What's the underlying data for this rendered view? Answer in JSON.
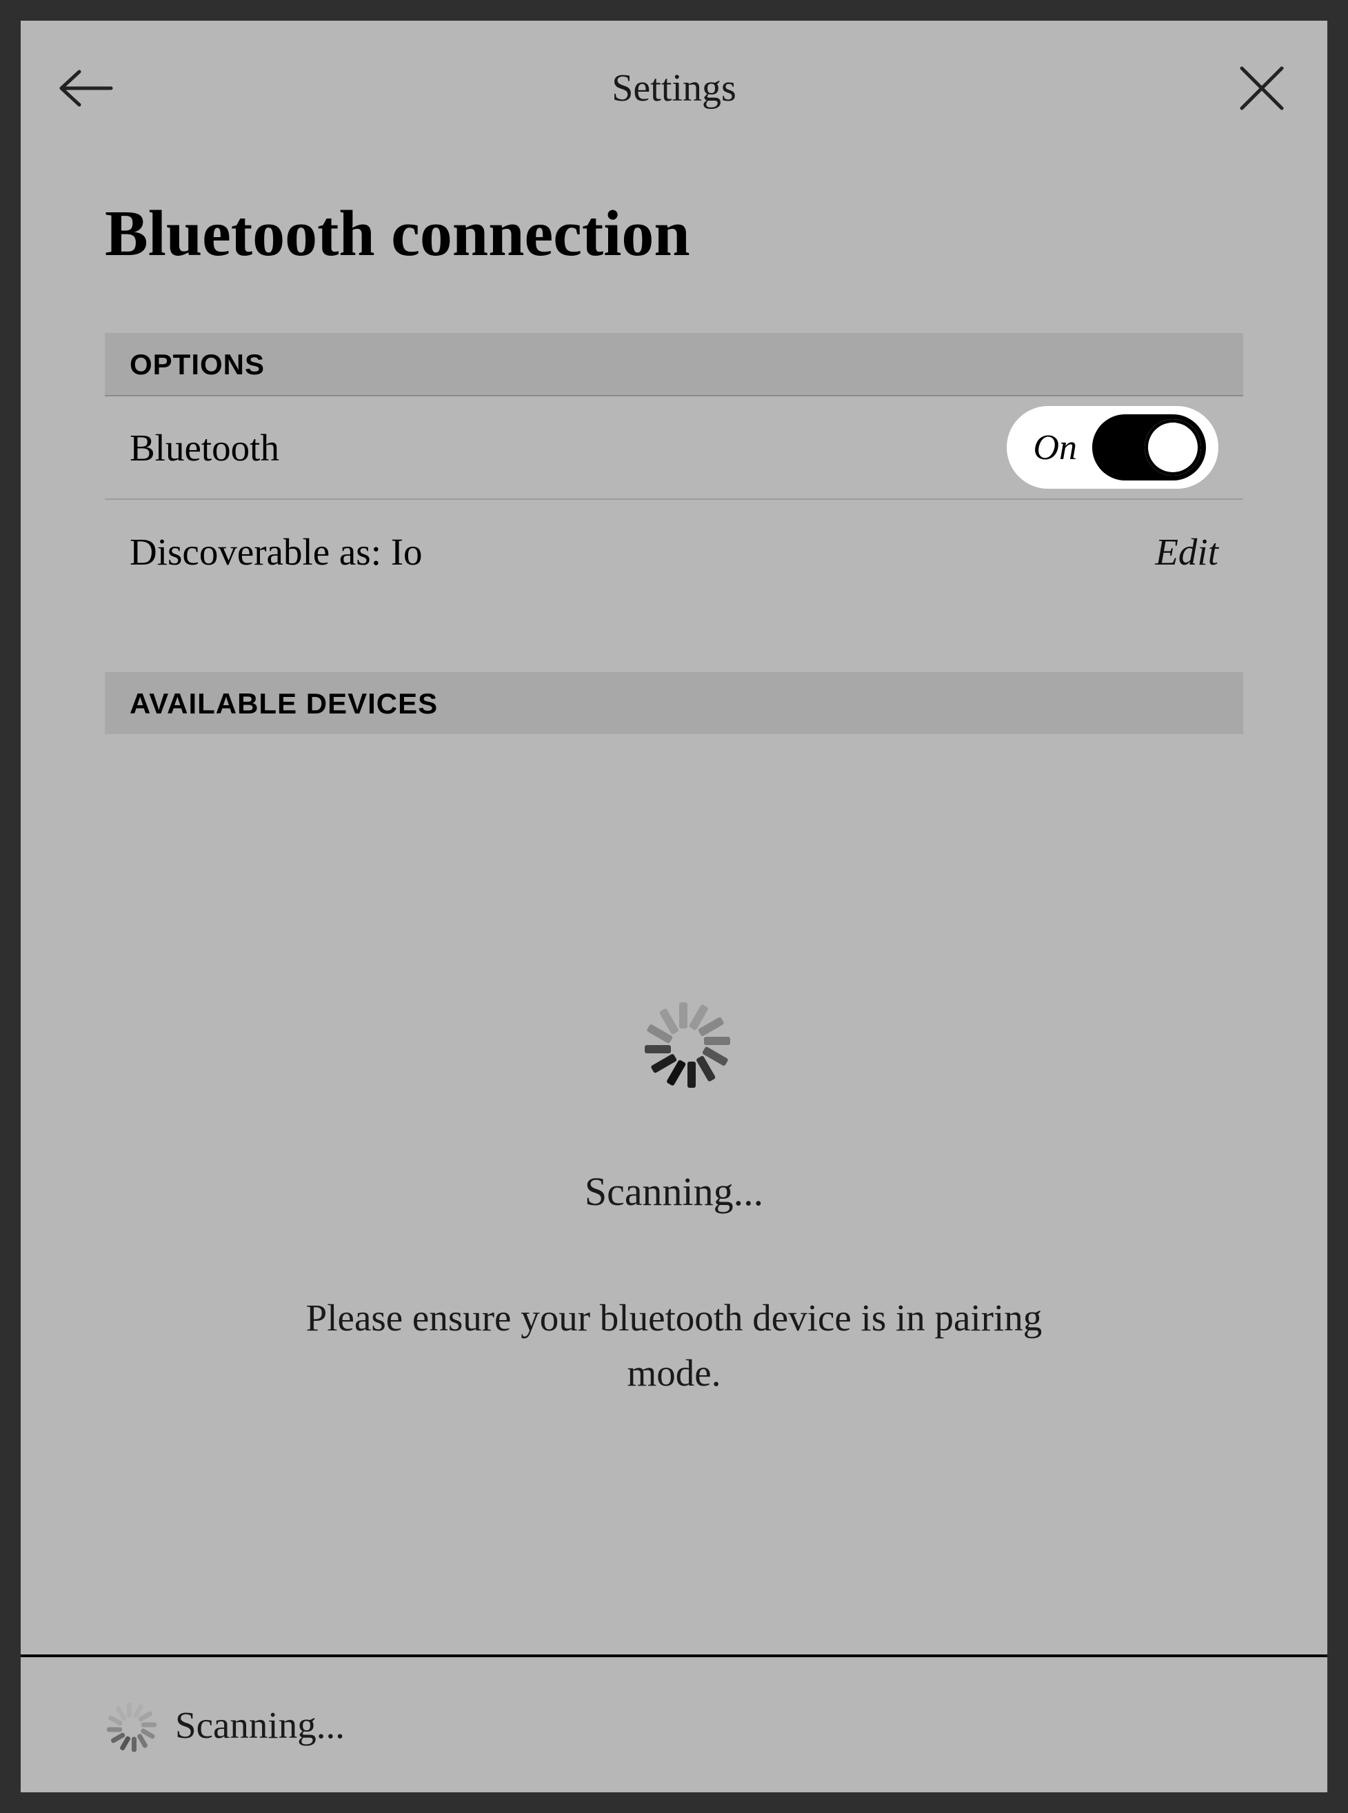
{
  "header": {
    "title": "Settings"
  },
  "page": {
    "title": "Bluetooth connection"
  },
  "options": {
    "section_label": "OPTIONS",
    "bluetooth_label": "Bluetooth",
    "toggle_state": "On",
    "discoverable_label": "Discoverable as: Io",
    "edit_label": "Edit"
  },
  "devices": {
    "section_label": "AVAILABLE DEVICES"
  },
  "scanning": {
    "title": "Scanning...",
    "subtitle": "Please ensure your bluetooth device is in pairing mode."
  },
  "footer": {
    "status": "Scanning..."
  }
}
